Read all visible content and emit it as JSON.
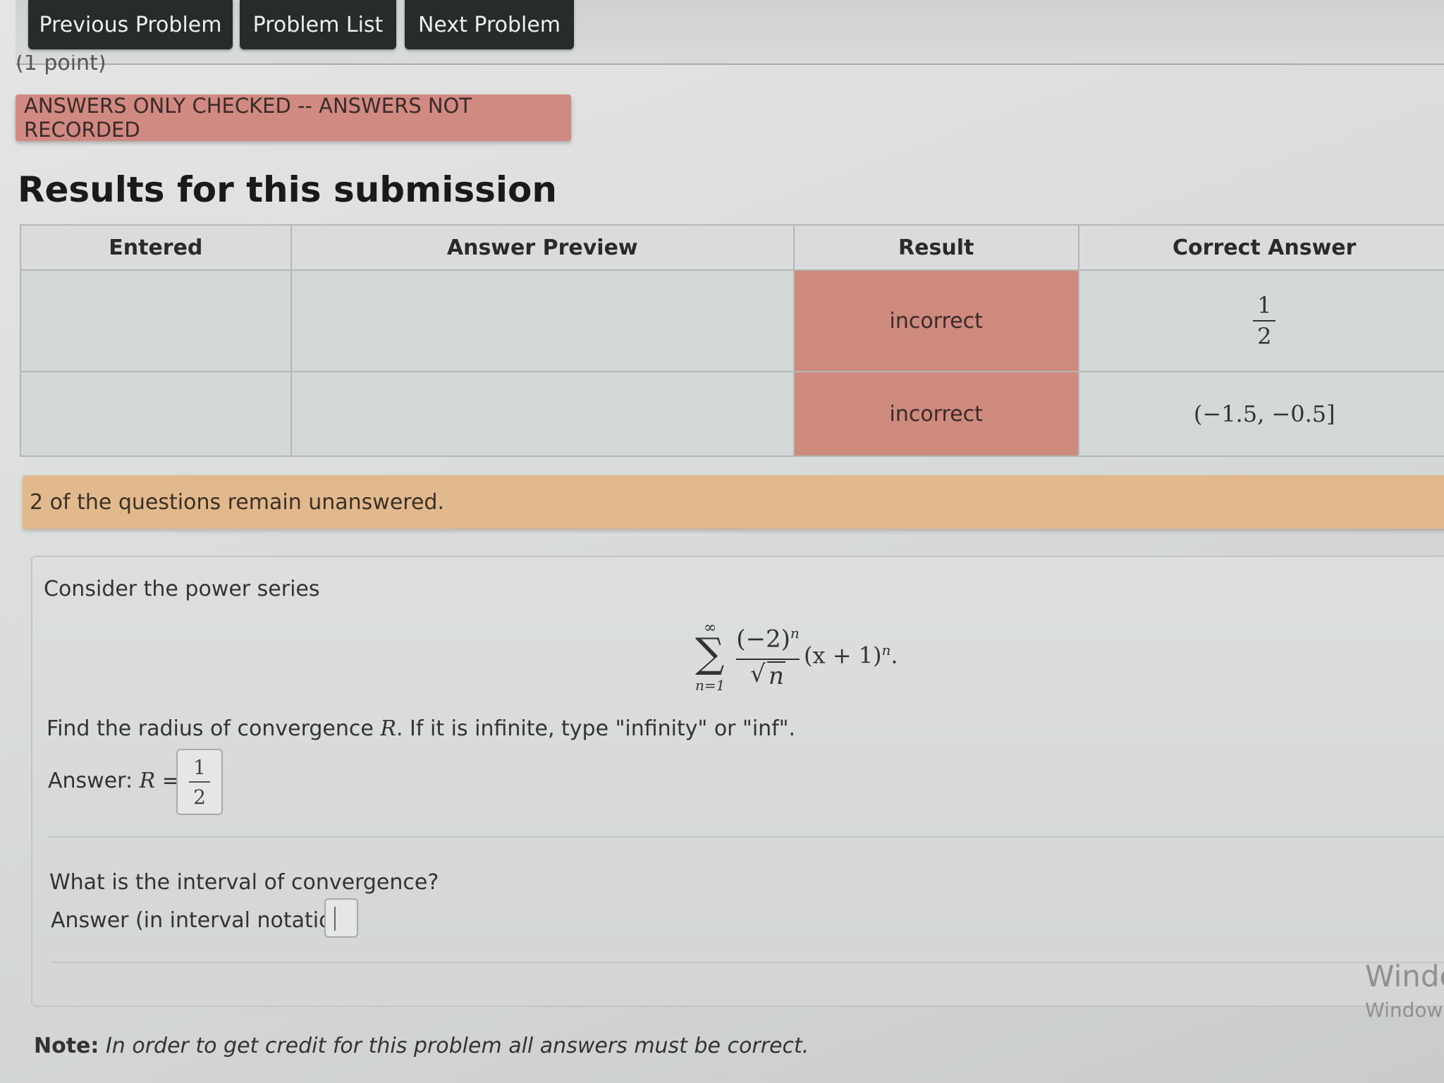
{
  "nav": {
    "previous": "Previous Problem",
    "list": "Problem List",
    "next": "Next Problem"
  },
  "points_label": "(1 point)",
  "alert_checked": "ANSWERS ONLY CHECKED -- ANSWERS NOT RECORDED",
  "results": {
    "title": "Results for this submission",
    "headers": [
      "Entered",
      "Answer Preview",
      "Result",
      "Correct Answer"
    ],
    "rows": [
      {
        "entered": "",
        "preview": "",
        "result": "incorrect",
        "correct_num": "1",
        "correct_den": "2"
      },
      {
        "entered": "",
        "preview": "",
        "result": "incorrect",
        "correct": "(−1.5, −0.5]"
      }
    ]
  },
  "unanswered_message": "2 of the questions remain unanswered.",
  "problem": {
    "intro": "Consider the power series",
    "series": {
      "upper": "∞",
      "lower": "n=1",
      "numerator": "(−2)",
      "numerator_exp": "n",
      "denominator": "n",
      "tail": "(x + 1)",
      "tail_exp": "n",
      "end": "."
    },
    "q1_text_before": "Find the radius of convergence ",
    "q1_var": "R",
    "q1_text_after": ". If it is infinite, type \"infinity\" or \"inf\".",
    "q1_label": "Answer: ",
    "q1_label_var": "R",
    "q1_label_eq": " =",
    "q1_value_num": "1",
    "q1_value_den": "2",
    "q2_text": "What is the interval of convergence?",
    "q2_label": "Answer (in interval notation):",
    "q2_value": ""
  },
  "watermark": {
    "line1": "Windo",
    "line2": "Window"
  },
  "note": {
    "bold": "Note:",
    "text": " In order to get credit for this problem all answers must be correct."
  }
}
